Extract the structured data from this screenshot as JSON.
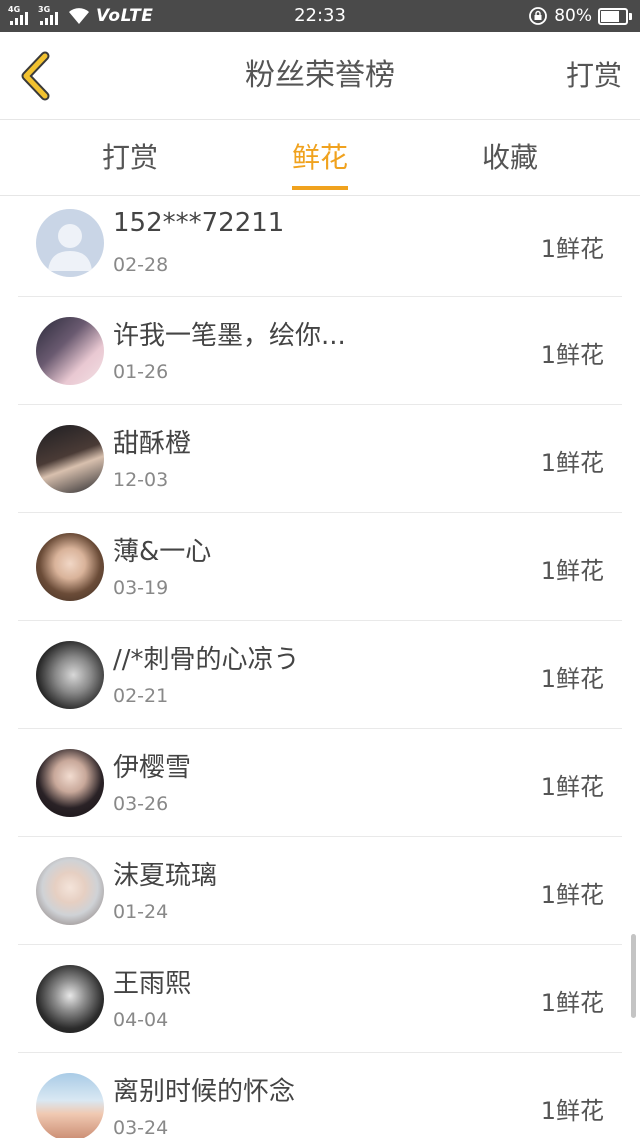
{
  "status_bar": {
    "net_tag_1": "4G",
    "net_tag_2": "3G",
    "carrier_label": "VoLTE",
    "time": "22:33",
    "battery_text": "80%",
    "battery_level": 0.8
  },
  "header": {
    "title": "粉丝荣誉榜",
    "right_action": "打赏",
    "accent_color": "#f0a21e"
  },
  "tabs": [
    {
      "label": "打赏",
      "active": false
    },
    {
      "label": "鲜花",
      "active": true
    },
    {
      "label": "收藏",
      "active": false
    }
  ],
  "fans": [
    {
      "name": "152***72211",
      "date": "02-28",
      "gift": "1鲜花"
    },
    {
      "name": "许我一笔墨，绘你...",
      "date": "01-26",
      "gift": "1鲜花"
    },
    {
      "name": "甜酥橙",
      "date": "12-03",
      "gift": "1鲜花"
    },
    {
      "name": "薄&一心",
      "date": "03-19",
      "gift": "1鲜花"
    },
    {
      "name": "//*刺骨的心凉う",
      "date": "02-21",
      "gift": "1鲜花"
    },
    {
      "name": "伊樱雪",
      "date": "03-26",
      "gift": "1鲜花"
    },
    {
      "name": "沫夏琉璃",
      "date": "01-24",
      "gift": "1鲜花"
    },
    {
      "name": "王雨熙",
      "date": "04-04",
      "gift": "1鲜花"
    },
    {
      "name": "离别时候的怀念",
      "date": "03-24",
      "gift": "1鲜花"
    }
  ]
}
